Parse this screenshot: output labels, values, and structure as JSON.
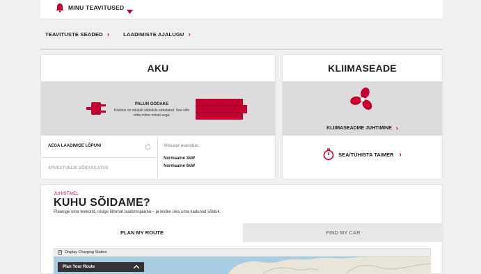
{
  "topbar": {
    "label": "MINU TEAVITUSED"
  },
  "links": [
    {
      "label": "TEAVITUSTE SEADED"
    },
    {
      "label": "LAADIMISTE AJALUGU"
    }
  ],
  "aku": {
    "title": "AKU",
    "status_title": "PALUN OODAKE",
    "status_text": "Käsklus on edukalt sõidukile edastatud. See võib võtta mõne minuti aega.",
    "time_label": "AEGA LAADIMISE LÕPUNI",
    "range_label": "ARVESTUSLIK SÕIDUULATUS",
    "last_update_label": "Viimane uuendus:",
    "normal3": "Normaalne 3kW",
    "normal6": "Normaalne 6kW"
  },
  "klima": {
    "title": "KLIIMASEADE",
    "control_label": "KLIIMASEADME JUHTIMINE",
    "timer_label": "SEA/TÜHISTA TAIMER"
  },
  "route": {
    "overline": "JUHISTMEL",
    "heading": "KUHU SÕIDAME?",
    "subtitle": "Plaanige oma teekond, otsige lähimat laadimisjaama – ja leidke üles oma kadunud sõiduk.",
    "tab_plan": "PLAN MY ROUTE",
    "tab_find": "FIND MY CAR",
    "display_label": "Display Charging Station",
    "plan_box": "Plan Your Route"
  },
  "colors": {
    "accent": "#c3002f"
  }
}
